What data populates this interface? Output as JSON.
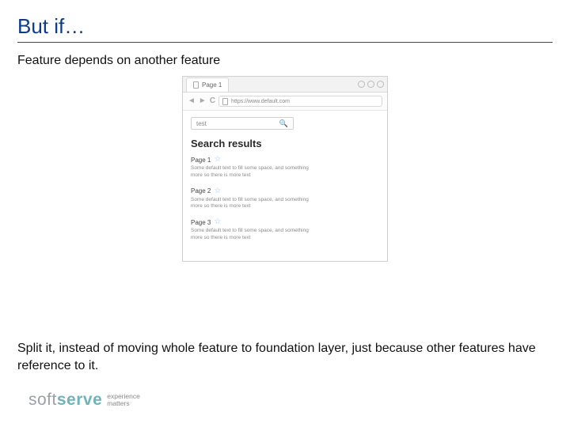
{
  "title": "But if…",
  "subtitle": "Feature depends on another feature",
  "footer": "Split it, instead of moving whole feature to foundation layer, just because other features have reference to it.",
  "browser": {
    "tab_label": "Page 1",
    "url": "https://www.default.com",
    "search_value": "test",
    "results_header": "Search results",
    "results": [
      {
        "title": "Page 1",
        "body": "Some default text to fill some space, and something more so there is more text"
      },
      {
        "title": "Page 2",
        "body": "Some default text to fill some space, and something more so there is more text"
      },
      {
        "title": "Page 3",
        "body": "Some default text to fill some space, and something more so there is more text"
      }
    ]
  },
  "logo": {
    "part1": "soft",
    "part2": "serve",
    "tag1": "experience",
    "tag2": "matters"
  }
}
